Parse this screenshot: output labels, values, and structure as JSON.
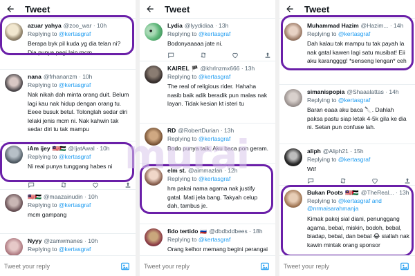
{
  "colors": {
    "accent": "#1d9bf0",
    "highlight_ring": "#6a1fa8",
    "text": "#0f1419",
    "muted": "#536471"
  },
  "watermark": "murai",
  "panels": [
    {
      "title": "Tweet",
      "reply_placeholder": "Tweet your reply",
      "tweets": [
        {
          "name": "azuar yahya",
          "flags": "",
          "handle": "@zoo_war",
          "time": "· 10h",
          "replying": "Replying to",
          "mention": "@kertasgraf",
          "text": "Berapa byk pil kuda yg dia telan ni? Dia punya pegi lain mcm."
        },
        {
          "name": "nana",
          "flags": "",
          "handle": "@frhananzm",
          "time": "· 10h",
          "replying": "Replying to",
          "mention": "@kertasgraf",
          "text": "Nak nikah dah minta orang duit. Belum lagi kau nak hidup dengan orang tu. Eeee busuk betul. Tolonglah sedar diri lelaki jenis mcm ni. Nak kahwin tak sedar diri tu tak mampu"
        },
        {
          "name": "iAm ijey",
          "flags": "🇲🇾🇵🇸",
          "handle": "@IjatAwal",
          "time": "· 10h",
          "replying": "Replying to",
          "mention": "@kertasgraf",
          "text": "Ni real punya tunggang habes ni"
        },
        {
          "name": "",
          "flags": "🇲🇾🇵🇸",
          "handle": "@maazainudin",
          "time": "· 10h",
          "replying": "Replying to",
          "mention": "@kertasgraf",
          "text": "mcm gampang"
        },
        {
          "name": "Nyyy",
          "flags": "",
          "handle": "@zamwmanes",
          "time": "· 10h",
          "replying": "Replying to",
          "mention": "@kertasgraf",
          "text": ""
        }
      ]
    },
    {
      "title": "Tweet",
      "reply_placeholder": "Tweet your reply",
      "tweets": [
        {
          "name": "Lydia",
          "flags": "",
          "handle": "@lyydidiaa",
          "time": "· 13h",
          "replying": "Replying to",
          "mention": "@kertasgraf",
          "text": "Bodonyaaaaa jate ni."
        },
        {
          "name": "KAIREL",
          "flags": "🏴",
          "handle": "@khrlnzmx666",
          "time": "· 13h",
          "replying": "Replying to",
          "mention": "@kertasgraf",
          "text": "The real of religious rider. Hahaha nasib baik adik beradik pun malas nak layan. Tidak kesian kt isteri tu"
        },
        {
          "name": "RD",
          "flags": "",
          "handle": "@RobertDurian",
          "time": "· 13h",
          "replying": "Replying to",
          "mention": "@kertasgraf",
          "text": "Bodo punya taik. Aku baca pon geram."
        },
        {
          "name": "elm st.",
          "flags": "",
          "handle": "@aimmazlan",
          "time": "· 12h",
          "replying": "Replying to",
          "mention": "@kertasgraf",
          "text": "hm pakai nama agama nak justify gatal. Mati jela bang. Takyah celup dah, tambus je."
        },
        {
          "name": "fido tertido",
          "flags": "🇷🇺",
          "handle": "@dbdbddbees",
          "time": "· 18h",
          "replying": "Replying to",
          "mention": "@kertasgraf",
          "text": "Orang kelhor memang begini perangai"
        }
      ]
    },
    {
      "title": "Tweet",
      "reply_placeholder": "Tweet your reply",
      "tweets": [
        {
          "name": "Muhammad Hazim",
          "flags": "",
          "handle": "@Hazim...",
          "time": "· 14h",
          "replying": "Replying to",
          "mention": "@kertasgraf",
          "text": "Dah kalau tak mampu tu tak payah la nak gatal kawen lagi satu musibat! Eii aku karangggg! *senseng lengan* ceh"
        },
        {
          "name": "simanispopia",
          "flags": "",
          "handle": "@Shaaalattas",
          "time": "· 14h",
          "replying": "Replying to",
          "mention": "@kertasgraf",
          "text": "Baran eaaa aku baca 🔪. Dahlah paksa pastu siap letak 4-5k gila ke dia ni. Setan pun confuse lah."
        },
        {
          "name": "aliph",
          "flags": "",
          "handle": "@Aliph21",
          "time": "· 15h",
          "replying": "Replying to",
          "mention": "@kertasgraf",
          "text": "Wtf"
        },
        {
          "name": "Bukan Poots",
          "flags": "🇲🇾🇵🇸",
          "handle": "@TheReal...",
          "time": "· 13h",
          "replying": "Replying to",
          "mention": "@kertasgraf and @nrmaisarahmanja",
          "text": "Kimak pakej sial diani, penunggang agama, bebal, miskin, bodoh, bebal, biadap, bebal, dan bebal 😂 siallah nak kawin mintak orang sponsor"
        }
      ]
    }
  ]
}
